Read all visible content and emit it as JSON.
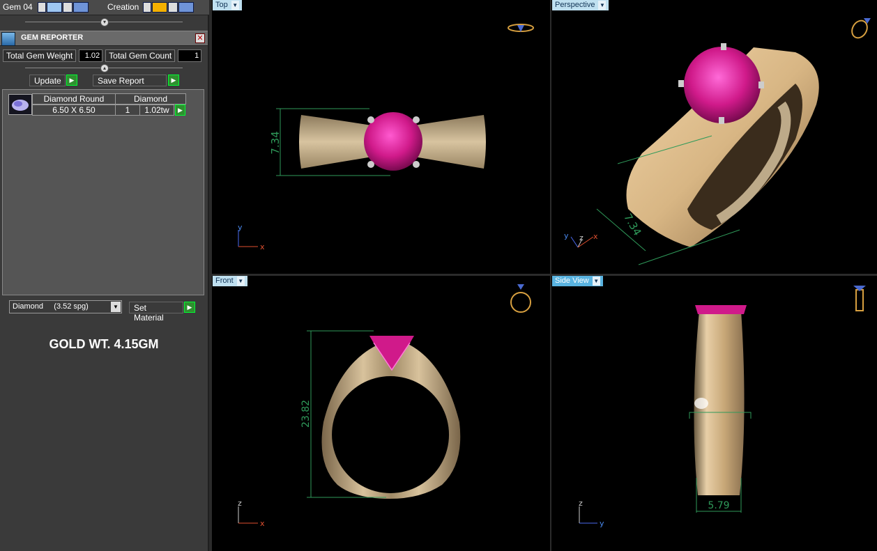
{
  "toolbar": {
    "gem_label": "Gem 04",
    "creation_label": "Creation"
  },
  "gem_reporter": {
    "title": "GEM REPORTER",
    "close_glyph": "✕",
    "total_weight_label": "Total Gem Weight",
    "total_weight_value": "1.02",
    "total_count_label": "Total Gem Count",
    "total_count_value": "1",
    "update_label": "Update",
    "save_report_label": "Save Report",
    "table_headers": [
      "Diamond Round",
      "Diamond"
    ],
    "rows": [
      {
        "size": "6.50 X 6.50",
        "count": "1",
        "weight": "1.02tw"
      }
    ],
    "material_select": "Diamond     (3.52 spg)",
    "set_material_label": "Set Material"
  },
  "annotation": "GOLD WT. 4.15GM",
  "viewports": {
    "top": {
      "label": "Top",
      "dimension": "7.34",
      "axes": [
        "y",
        "x"
      ]
    },
    "perspective": {
      "label": "Perspective",
      "dimension": "7.34",
      "axes": [
        "y",
        "z",
        "x"
      ]
    },
    "front": {
      "label": "Front",
      "dimension": "23.82",
      "axes": [
        "z",
        "x"
      ]
    },
    "side": {
      "label": "Side View",
      "dimension": "5.79",
      "axes": [
        "z",
        "y"
      ]
    }
  },
  "colors": {
    "viewport_bg": "#000000",
    "gold": "#c8a878",
    "ruby": "#d01a8a",
    "dimension_line": "#2f9a5a",
    "tab_active": "#59b3e0",
    "tab_inactive": "#bfe0f0"
  }
}
